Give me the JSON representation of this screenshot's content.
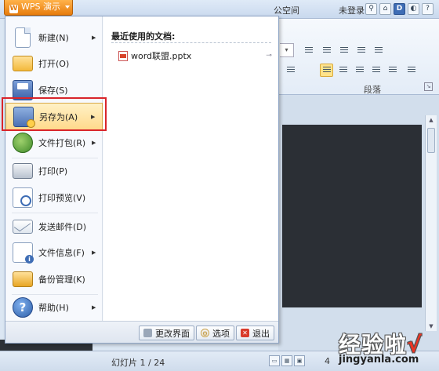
{
  "app": {
    "menu_button_label": "WPS 演示",
    "title_partial": "公空间",
    "login_label": "未登录",
    "toolbar_icons": [
      "user-icon",
      "shirt-icon",
      "d-icon",
      "palette-icon",
      "help-icon"
    ],
    "toolbar_icon_glyphs": [
      "⚲",
      "⌂",
      "D",
      "◐",
      "?"
    ]
  },
  "ribbon": {
    "group_label": "段落",
    "combo_arrow": "▾",
    "launcher_glyph": "↘"
  },
  "menu": {
    "items": [
      {
        "label": "新建(N)",
        "has_submenu": true,
        "icon": "new-document-icon"
      },
      {
        "label": "打开(O)",
        "has_submenu": false,
        "icon": "open-folder-icon"
      },
      {
        "label": "保存(S)",
        "has_submenu": false,
        "icon": "save-icon"
      },
      {
        "label": "另存为(A)",
        "has_submenu": true,
        "icon": "save-as-icon",
        "selected": true
      },
      {
        "label": "文件打包(R)",
        "has_submenu": true,
        "icon": "package-icon"
      },
      {
        "label": "打印(P)",
        "has_submenu": false,
        "icon": "print-icon"
      },
      {
        "label": "打印预览(V)",
        "has_submenu": false,
        "icon": "print-preview-icon"
      },
      {
        "label": "发送邮件(D)",
        "has_submenu": false,
        "icon": "mail-icon"
      },
      {
        "label": "文件信息(F)",
        "has_submenu": true,
        "icon": "file-info-icon"
      },
      {
        "label": "备份管理(K)",
        "has_submenu": false,
        "icon": "backup-folder-icon"
      },
      {
        "label": "帮助(H)",
        "has_submenu": true,
        "icon": "help-icon"
      }
    ],
    "submenu_arrow": "▶",
    "help_glyph": "?"
  },
  "recent": {
    "header": "最近使用的文档:",
    "files": [
      {
        "name": "word联盟.pptx",
        "icon": "pptx-file-icon",
        "pin_glyph": "⊸"
      }
    ]
  },
  "menu_footer": {
    "change_ui_label": "更改界面",
    "options_label": "选项",
    "exit_label": "退出",
    "exit_glyph": "✕",
    "options_glyph": "⚙"
  },
  "status": {
    "slide_count": "幻灯片 1 / 24",
    "zoom_partial": "4"
  },
  "watermark": {
    "text": "经验啦",
    "check": "√",
    "url": "jingyanla.com"
  },
  "colors": {
    "highlight": "#d9252b",
    "wps_orange": "#e77c0d",
    "selected_item": "#ffd98a"
  }
}
